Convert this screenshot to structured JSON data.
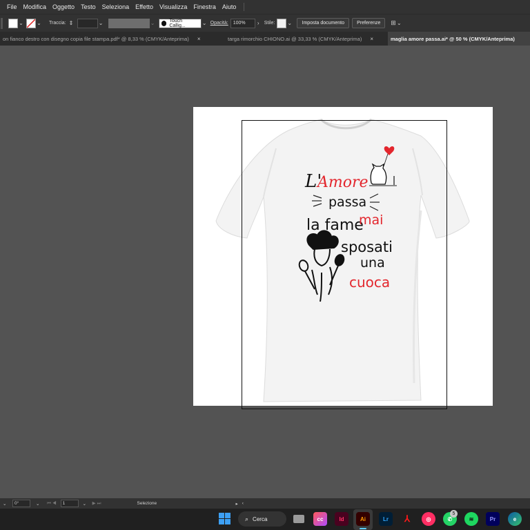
{
  "menu": [
    "File",
    "Modifica",
    "Oggetto",
    "Testo",
    "Seleziona",
    "Effetto",
    "Visualizza",
    "Finestra",
    "Aiuto"
  ],
  "control": {
    "stroke_label": "Traccia:",
    "brush": "Touch Callig...",
    "opacity_label": "Opacità:",
    "opacity_value": "100%",
    "style_label": "Stile:",
    "doc_setup_button": "Imposta documento",
    "prefs_button": "Preferenze"
  },
  "tabs": [
    {
      "label": "on fianco destro con disegno copia file stampa.pdf* @ 8,33 % (CMYK/Anteprima)",
      "active": false
    },
    {
      "label": "targa rimorchio CHIONO.ai @ 33,33 % (CMYK/Anteprima)",
      "active": false
    },
    {
      "label": "maglia amore passa.ai* @ 50 % (CMYK/Anteprima)",
      "active": true
    }
  ],
  "artwork": {
    "line1_a": "L'",
    "line1_b": "Amore",
    "line2": "passa",
    "line3_a": "la fame",
    "line3_b": "mai",
    "line4": "sposati",
    "line5": "una",
    "line6": "cuoca"
  },
  "status": {
    "rotation": "0°",
    "artboard_num": "1",
    "tool": "Selezione"
  },
  "taskbar": {
    "search_label": "Cerca",
    "whatsapp_badge": "5",
    "apps": [
      "file-explorer-icon",
      "creative-cloud-icon",
      "indesign-icon",
      "illustrator-icon",
      "lightroom-icon",
      "acrobat-icon",
      "app-icon",
      "whatsapp-icon",
      "spotify-icon",
      "premiere-icon",
      "edge-icon"
    ]
  },
  "colors": {
    "ui_dark": "#323232",
    "canvas": "#535353",
    "accent_red": "#e3262d"
  }
}
